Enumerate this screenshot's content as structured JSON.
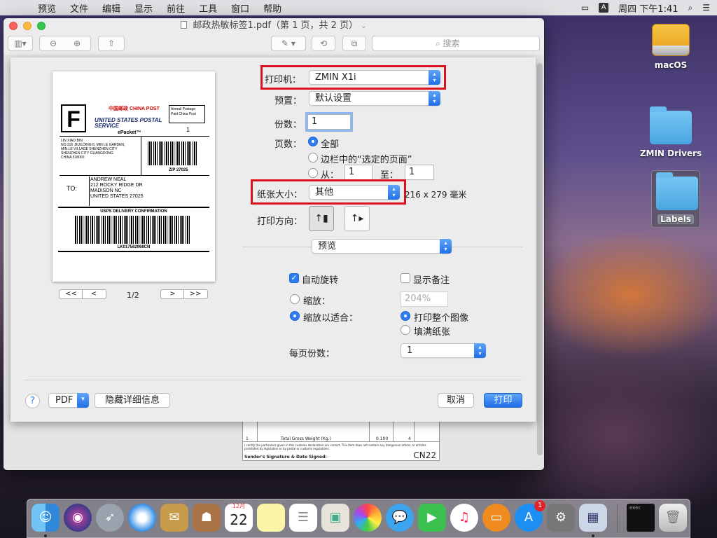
{
  "menubar": {
    "items": [
      "预览",
      "文件",
      "编辑",
      "显示",
      "前往",
      "工具",
      "窗口",
      "帮助"
    ],
    "input_label": "A",
    "clock": "周四 下午1:41"
  },
  "desktop": {
    "icons": [
      "macOS",
      "ZMIN Drivers",
      "Labels"
    ]
  },
  "window": {
    "title": "邮政热敏标签1.pdf（第 1 页，共 2 页）",
    "search_placeholder": "搜索"
  },
  "label_preview": {
    "big_letter": "F",
    "china_post": "中国邮政 CHINA POST",
    "usps": "UNITED STATES POSTAL SERVICE",
    "epacket": "ePacket™",
    "airmail": "Airmail Postage Paid China Post",
    "qty": "1",
    "from_lines": [
      "LIN XIAO BIN",
      "NO.316 ,BUILDING 8, MIN LE GARDEN,",
      "MIN LE VILLAGE SHENZHEN CITY",
      "SHENZHEN CITY GUANGDONG",
      "CHINA 518000"
    ],
    "zip": "ZIP 27025",
    "to_label": "TO:",
    "to_lines": [
      "ANDREW NEAL",
      "212 ROCKY RIDGE DR",
      "MADISON NC",
      "UNITED STATES 27025"
    ],
    "confirm": "USPS DELIVERY CONFIRMATION",
    "tracking": "LK017582968CN"
  },
  "pager": {
    "first": "<<",
    "prev": "<",
    "label": "1/2",
    "next": ">",
    "last": ">>"
  },
  "print": {
    "printer_label": "打印机：",
    "printer_value": "ZMIN X1i",
    "preset_label": "预置：",
    "preset_value": "默认设置",
    "copies_label": "份数：",
    "copies_value": "1",
    "pages_label": "页数：",
    "pages_all": "全部",
    "pages_selected": "边栏中的“选定的页面”",
    "pages_from": "从：",
    "pages_from_value": "1",
    "pages_to": "至：",
    "pages_to_value": "1",
    "paper_label": "纸张大小：",
    "paper_value": "其他",
    "paper_dims": "216 x 279 毫米",
    "orientation_label": "打印方向：",
    "app_section": "预览",
    "auto_rotate": "自动旋转",
    "show_notes": "显示备注",
    "scale_label": "缩放：",
    "scale_value": "204%",
    "scale_fit_label": "缩放以适合：",
    "print_entire": "打印整个图像",
    "fill_paper": "填满纸张",
    "per_page_label": "每页份数：",
    "per_page_value": "1",
    "help": "?",
    "pdf": "PDF",
    "hide_details": "隐藏详细信息",
    "cancel": "取消",
    "print": "打印"
  },
  "cn22": {
    "row_no": "1",
    "gross_label": "Total Gross Weight (Kg.)",
    "weight": "0.100",
    "value": "4",
    "declare": "I certify the particulars given in this customs declaration are correct. This item does not contain any dangerous article, or articles prohibited by legislation or by postal or customs regulations.",
    "sign": "Sender's Signature & Date Signed:",
    "code": "CN22"
  },
  "dock": {
    "calendar_month": "12月",
    "calendar_day": "22",
    "appstore_badge": "1",
    "terminal": "exec"
  }
}
